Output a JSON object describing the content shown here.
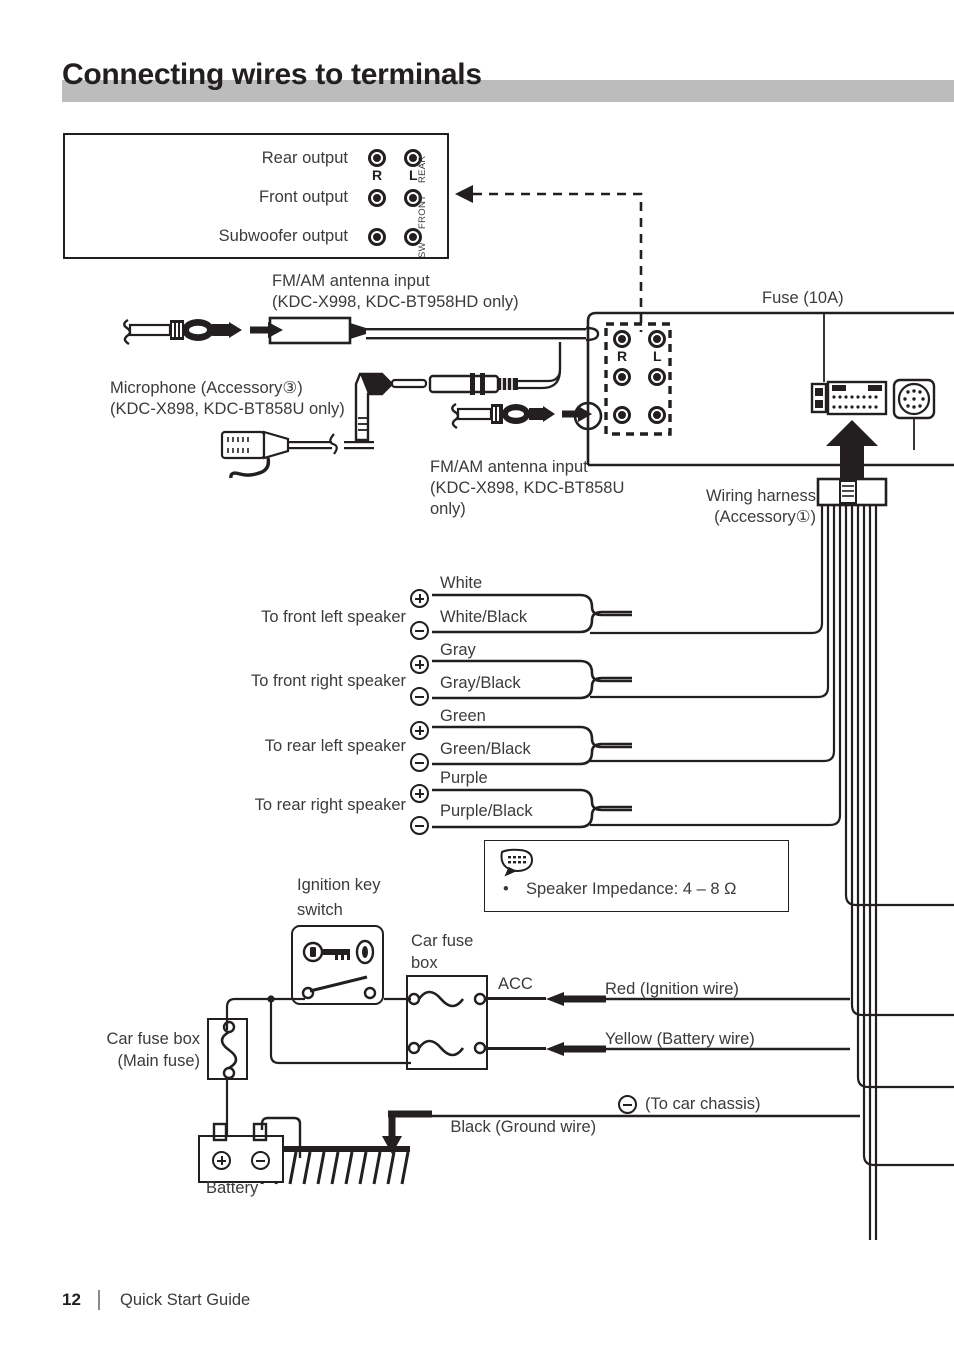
{
  "page": {
    "title": "Connecting wires to terminals",
    "footer_page_number": "12",
    "footer_text": "Quick Start Guide",
    "accent_bar_color": "#bcbcbc",
    "ink_color": "#231f20"
  },
  "output_detail_box": {
    "rows": [
      {
        "label": "Rear output",
        "side_label": "REAR"
      },
      {
        "label": "Front output",
        "side_label": "FRONT"
      },
      {
        "label": "Subwoofer output",
        "side_label": "SW"
      }
    ],
    "channel_right": "R",
    "channel_left": "L"
  },
  "annotations": {
    "antenna_top_line1": "FM/AM antenna input",
    "antenna_top_line2": "(KDC-X998, KDC-BT958HD only)",
    "microphone_line1": "Microphone (Accessory③)",
    "microphone_line2": "(KDC-X898, KDC-BT858U only)",
    "antenna_bottom_line1": "FM/AM antenna input",
    "antenna_bottom_line2": "(KDC-X898, KDC-BT858U",
    "antenna_bottom_line3": "only)",
    "fuse": "Fuse (10A)",
    "wiring_harness_line1": "Wiring harness",
    "wiring_harness_line2": "(Accessory①)",
    "rca_right": "R",
    "rca_left": "L"
  },
  "speakers": [
    {
      "destination": "To front left speaker",
      "positive_wire": "White",
      "negative_wire": "White/Black",
      "positive_symbol": "+",
      "negative_symbol": "−"
    },
    {
      "destination": "To front right speaker",
      "positive_wire": "Gray",
      "negative_wire": "Gray/Black",
      "positive_symbol": "+",
      "negative_symbol": "−"
    },
    {
      "destination": "To rear left speaker",
      "positive_wire": "Green",
      "negative_wire": "Green/Black",
      "positive_symbol": "+",
      "negative_symbol": "−"
    },
    {
      "destination": "To rear right speaker",
      "positive_wire": "Purple",
      "negative_wire": "Purple/Black",
      "positive_symbol": "+",
      "negative_symbol": "−"
    }
  ],
  "note": {
    "bullet": "•",
    "text": "Speaker Impedance: 4 – 8 Ω",
    "icon": "note-bubble-icon"
  },
  "power": {
    "ignition_switch_line1": "Ignition key",
    "ignition_switch_line2": "switch",
    "car_fuse_box_line1": "Car fuse",
    "car_fuse_box_line2": "box",
    "main_fuse_line1": "Car fuse box",
    "main_fuse_line2": "(Main fuse)",
    "acc_label": "ACC",
    "ignition_wire": "Red (Ignition wire)",
    "battery_wire": "Yellow (Battery wire)",
    "ground_wire_pre": "Black (Ground wire)",
    "ground_wire_post": "(To car chassis)",
    "ground_symbol": "−",
    "battery_label": "Battery",
    "battery_positive": "+",
    "battery_negative": "−"
  }
}
